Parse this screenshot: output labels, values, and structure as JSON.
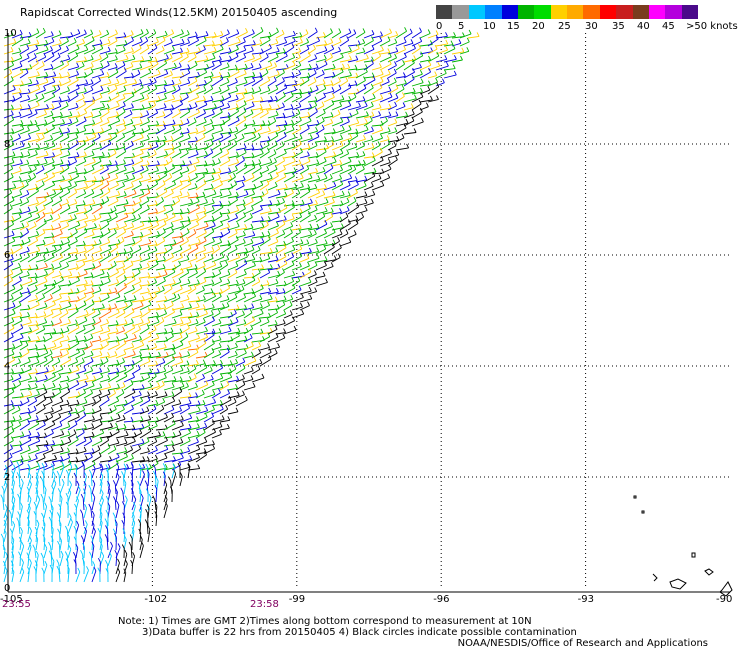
{
  "title": "Rapidscat Corrected Winds(12.5KM) 20150405 ascending",
  "legend": {
    "colors": [
      "#444444",
      "#999999",
      "#00c8ff",
      "#0080ff",
      "#0000dd",
      "#00b400",
      "#00dd00",
      "#ffd000",
      "#ffaa00",
      "#ff6a00",
      "#ff0000",
      "#c81e1e",
      "#7a3c1e",
      "#ff00ff",
      "#b400dd",
      "#4a0a8a"
    ],
    "labels": [
      "0",
      "5",
      "10",
      "15",
      "20",
      "25",
      "30",
      "35",
      "40",
      "45",
      ">50 knots"
    ]
  },
  "map": {
    "lat_labels": [
      "10",
      "8",
      "6",
      "4",
      "2",
      "0"
    ],
    "lon_labels": [
      "-105",
      "-102",
      "-99",
      "-96",
      "-93",
      "-90"
    ],
    "lon_range": [
      -105,
      -90
    ],
    "lat_range": [
      0,
      10
    ],
    "vector_colors": {
      "calm": "#000000",
      "light": "#00c8ff",
      "moderate": "#0000dd",
      "fresh": "#00b400",
      "strong": "#ffd000",
      "gale": "#ff6a00"
    }
  },
  "times": {
    "left": "23:55",
    "center": "23:58"
  },
  "notes": {
    "line1": "Note: 1) Times are GMT 2)Times along bottom correspond to measurement at 10N",
    "line2": "3)Data buffer is 22 hrs from 20150405 4) Black circles indicate possible contamination"
  },
  "credit": "NOAA/NESDIS/Office of Research and Applications"
}
